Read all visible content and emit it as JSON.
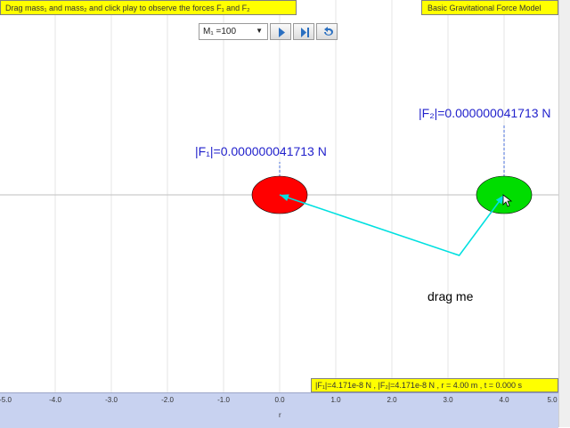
{
  "header": {
    "instruction": "Drag mass₁ and mass₂ and click play to observe the forces F₁ and F₂",
    "model_title": "Basic Gravitational Force Model"
  },
  "toolbar": {
    "mass_select_value": "M₁ =100",
    "dropdown_arrow": "▼"
  },
  "forces": {
    "f1_label": "|F₁|=0.000000041713 N",
    "f2_label": "|F₂|=0.000000041713 N"
  },
  "drag_label": "drag me",
  "status": "|F₁|=4.171e-8 N , |F₂|=4.171e-8 N , r = 4.00 m , t = 0.000 s",
  "axis": {
    "label": "r",
    "ticks": [
      {
        "value": -5.0,
        "text": "-5.0"
      },
      {
        "value": -4.0,
        "text": "-4.0"
      },
      {
        "value": -3.0,
        "text": "-3.0"
      },
      {
        "value": -2.0,
        "text": "-2.0"
      },
      {
        "value": -1.0,
        "text": "-1.0"
      },
      {
        "value": 0.0,
        "text": "0.0"
      },
      {
        "value": 1.0,
        "text": "1.0"
      },
      {
        "value": 2.0,
        "text": "2.0"
      },
      {
        "value": 3.0,
        "text": "3.0"
      },
      {
        "value": 4.0,
        "text": "4.0"
      },
      {
        "value": 5.0,
        "text": "5.0"
      }
    ]
  },
  "masses": {
    "mass1": {
      "position": 0.0,
      "color": "#ff0000"
    },
    "mass2": {
      "position": 4.0,
      "color": "#00dd00"
    }
  },
  "drag_point": {
    "x": 3.2,
    "y": -1.8
  },
  "colors": {
    "force_arrow": "#0066cc",
    "drag_line": "#00e0e0",
    "label_blue": "#2222cc",
    "panel_yellow": "#ffff00"
  }
}
